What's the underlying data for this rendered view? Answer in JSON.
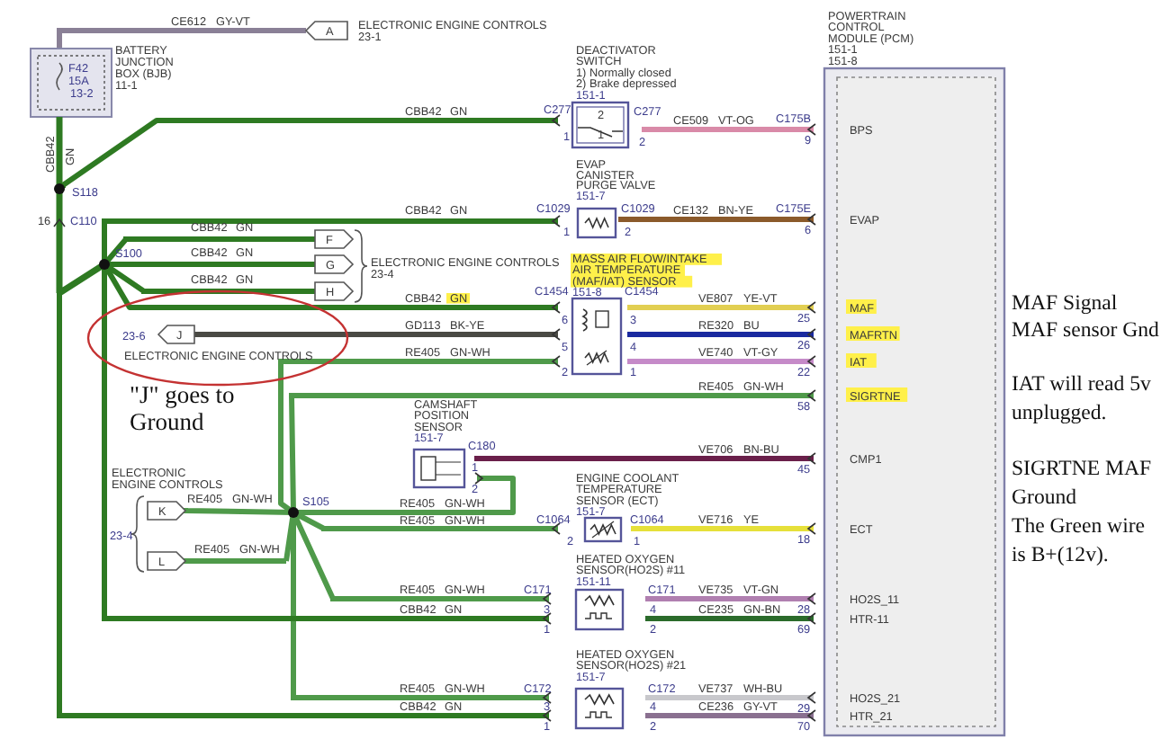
{
  "top_feed": {
    "circuit": "CE612",
    "color_code": "GY-VT",
    "color": "#8a8096",
    "connector": "A",
    "target_lines": [
      "ELECTRONIC ENGINE CONTROLS",
      "23-1"
    ]
  },
  "battery_junction_box": {
    "label_lines": [
      "BATTERY",
      "JUNCTION",
      "BOX (BJB)",
      "11-1"
    ],
    "fuse_lines": [
      "F42",
      "15A",
      "13-2"
    ]
  },
  "feed_wire": {
    "circuit": "CBB42",
    "color_code": "GN",
    "color": "#2e7a22"
  },
  "splices": [
    "S118",
    "S100",
    "S105"
  ],
  "inline_connector": {
    "pin": "16",
    "name": "C110"
  },
  "eec_connectors_upper": {
    "letters": [
      "F",
      "G",
      "H"
    ],
    "label_lines": [
      "ELECTRONIC ENGINE CONTROLS",
      "23-4"
    ]
  },
  "ground_connector": {
    "page": "23-6",
    "letter": "J",
    "label": "ELECTRONIC ENGINE CONTROLS",
    "circled": true
  },
  "ground_note": {
    "lines": [
      "\"J\" goes to",
      "Ground"
    ]
  },
  "eec_connectors_lower": {
    "label_lines": [
      "ELECTRONIC",
      "ENGINE CONTROLS"
    ],
    "page": "23-4",
    "letters": [
      "K",
      "L"
    ]
  },
  "wires": [
    {
      "circuit": "CBB42",
      "color_code": "GN",
      "color": "#2e7a22",
      "highlighted": false
    },
    {
      "circuit": "CBB42",
      "color_code": "GN",
      "color": "#2e7a22",
      "highlighted": false
    },
    {
      "circuit": "CBB42",
      "color_code": "GN",
      "color": "#2e7a22",
      "highlighted": false
    },
    {
      "circuit": "CBB42",
      "color_code": "GN",
      "color": "#2e7a22",
      "highlighted": false
    },
    {
      "circuit": "CBB42",
      "color_code": "GN",
      "color": "#2e7a22",
      "highlighted": false
    },
    {
      "circuit": "CBB42",
      "color_code": "GN",
      "color": "#2e7a22",
      "highlighted": true
    },
    {
      "circuit": "GD113",
      "color_code": "BK-YE",
      "color": "#4a4a44",
      "highlighted": false
    },
    {
      "circuit": "RE405",
      "color_code": "GN-WH",
      "color": "#4f9a4a",
      "highlighted": false
    },
    {
      "circuit": "RE405",
      "color_code": "GN-WH",
      "color": "#4f9a4a",
      "highlighted": false
    },
    {
      "circuit": "RE405",
      "color_code": "GN-WH",
      "color": "#4f9a4a",
      "highlighted": false
    },
    {
      "circuit": "RE405",
      "color_code": "GN-WH",
      "color": "#4f9a4a",
      "highlighted": false
    },
    {
      "circuit": "RE405",
      "color_code": "GN-WH",
      "color": "#4f9a4a",
      "highlighted": false
    },
    {
      "circuit": "RE405",
      "color_code": "GN-WH",
      "color": "#4f9a4a",
      "highlighted": false
    },
    {
      "circuit": "CBB42",
      "color_code": "GN",
      "color": "#2e7a22",
      "highlighted": false
    },
    {
      "circuit": "RE405",
      "color_code": "GN-WH",
      "color": "#4f9a4a",
      "highlighted": false
    },
    {
      "circuit": "CBB42",
      "color_code": "GN",
      "color": "#2e7a22",
      "highlighted": false
    },
    {
      "circuit": "CE509",
      "color_code": "VT-OG",
      "color": "#d98aa8",
      "highlighted": false
    },
    {
      "circuit": "CE132",
      "color_code": "BN-YE",
      "color": "#8b5a2b",
      "highlighted": false
    },
    {
      "circuit": "VE807",
      "color_code": "YE-VT",
      "color": "#e2cf52",
      "highlighted": false
    },
    {
      "circuit": "RE320",
      "color_code": "BU",
      "color": "#1a2aa0",
      "highlighted": false
    },
    {
      "circuit": "VE740",
      "color_code": "VT-GY",
      "color": "#c58ac8",
      "highlighted": false
    },
    {
      "circuit": "RE405",
      "color_code": "GN-WH",
      "color": "#4f9a4a",
      "highlighted": false
    },
    {
      "circuit": "VE706",
      "color_code": "BN-BU",
      "color": "#6a1f4a",
      "highlighted": false
    },
    {
      "circuit": "VE716",
      "color_code": "YE",
      "color": "#e6e03a",
      "highlighted": false
    },
    {
      "circuit": "VE735",
      "color_code": "VT-GN",
      "color": "#b07fb0",
      "highlighted": false
    },
    {
      "circuit": "CE235",
      "color_code": "GN-BN",
      "color": "#2b6b2b",
      "highlighted": false
    },
    {
      "circuit": "VE737",
      "color_code": "WH-BU",
      "color": "#c8c8cc",
      "highlighted": false
    },
    {
      "circuit": "CE236",
      "color_code": "GY-VT",
      "color": "#8a7090",
      "highlighted": false
    }
  ],
  "components": [
    {
      "kind": "switch",
      "label_lines": [
        "DEACTIVATOR",
        "SWITCH",
        "1) Normally closed",
        "2) Brake depressed",
        "151-1"
      ],
      "highlighted": false,
      "terminal_labels": [
        "2",
        "1"
      ],
      "left_connector": {
        "name": "C277",
        "pins": [
          "1"
        ]
      },
      "right_connector": {
        "name": "C277",
        "pins": [
          "2"
        ]
      }
    },
    {
      "kind": "solenoid",
      "label_lines": [
        "EVAP",
        "CANISTER",
        "PURGE VALVE",
        "151-7"
      ],
      "highlighted": false,
      "left_connector": {
        "name": "C1029",
        "pins": [
          "1"
        ]
      },
      "right_connector": {
        "name": "C1029",
        "pins": [
          "2"
        ]
      }
    },
    {
      "kind": "maf",
      "label_lines": [
        "MASS AIR FLOW/INTAKE",
        "AIR TEMPERATURE",
        "(MAF/IAT) SENSOR",
        "151-8"
      ],
      "highlighted": true,
      "left_connector": {
        "name": "C1454",
        "pins": [
          "6",
          "5",
          "2"
        ]
      },
      "right_connector": {
        "name": "C1454",
        "pins": [
          "3",
          "4",
          "1"
        ]
      }
    },
    {
      "kind": "position_sensor",
      "label_lines": [
        "CAMSHAFT",
        "POSITION",
        "SENSOR",
        "151-7"
      ],
      "highlighted": false,
      "right_connector": {
        "name": "C180",
        "pins": [
          "1",
          "2"
        ]
      }
    },
    {
      "kind": "thermistor",
      "label_lines": [
        "ENGINE COOLANT",
        "TEMPERATURE",
        "SENSOR (ECT)",
        "151-7"
      ],
      "highlighted": false,
      "left_connector": {
        "name": "C1064",
        "pins": [
          "2"
        ]
      },
      "right_connector": {
        "name": "C1064",
        "pins": [
          "1"
        ]
      }
    },
    {
      "kind": "oxygen_sensor",
      "label_lines": [
        "HEATED OXYGEN",
        "SENSOR(HO2S) #11",
        "151-11"
      ],
      "highlighted": false,
      "left_connector": {
        "name": "C171",
        "pins": [
          "3",
          "1"
        ]
      },
      "right_connector": {
        "name": "C171",
        "pins": [
          "4",
          "2"
        ]
      }
    },
    {
      "kind": "oxygen_sensor",
      "label_lines": [
        "HEATED OXYGEN",
        "SENSOR(HO2S) #21",
        "151-7"
      ],
      "highlighted": false,
      "left_connector": {
        "name": "C172",
        "pins": [
          "3",
          "1"
        ]
      },
      "right_connector": {
        "name": "C172",
        "pins": [
          "4",
          "2"
        ]
      }
    }
  ],
  "pcm": {
    "title_lines": [
      "POWERTRAIN",
      "CONTROL",
      "MODULE (PCM)",
      "151-1",
      "151-8"
    ],
    "pins": [
      {
        "connector": "C175B",
        "number": "9",
        "name": "BPS",
        "highlighted": false
      },
      {
        "connector": "C175E",
        "number": "6",
        "name": "EVAP",
        "highlighted": false
      },
      {
        "number": "25",
        "name": "MAF",
        "highlighted": true
      },
      {
        "number": "26",
        "name": "MAFRTN",
        "highlighted": true
      },
      {
        "number": "22",
        "name": "IAT",
        "highlighted": true
      },
      {
        "number": "58",
        "name": "SIGRTNE",
        "highlighted": true
      },
      {
        "number": "45",
        "name": "CMP1",
        "highlighted": false
      },
      {
        "number": "18",
        "name": "ECT",
        "highlighted": false
      },
      {
        "number": "28",
        "name": "HO2S_11",
        "highlighted": false
      },
      {
        "number": "69",
        "name": "HTR-11",
        "highlighted": false
      },
      {
        "number": "29",
        "name": "HO2S_21",
        "highlighted": false
      },
      {
        "number": "70",
        "name": "HTR_21",
        "highlighted": false
      }
    ]
  },
  "notes": [
    {
      "lines": [
        "MAF Signal"
      ]
    },
    {
      "lines": [
        "MAF sensor Gnd"
      ]
    },
    {
      "lines": [
        "IAT will read 5v",
        "unplugged."
      ]
    },
    {
      "lines": [
        "SIGRTNE MAF",
        "Ground",
        "The Green wire",
        "is B+(12v)."
      ]
    }
  ]
}
